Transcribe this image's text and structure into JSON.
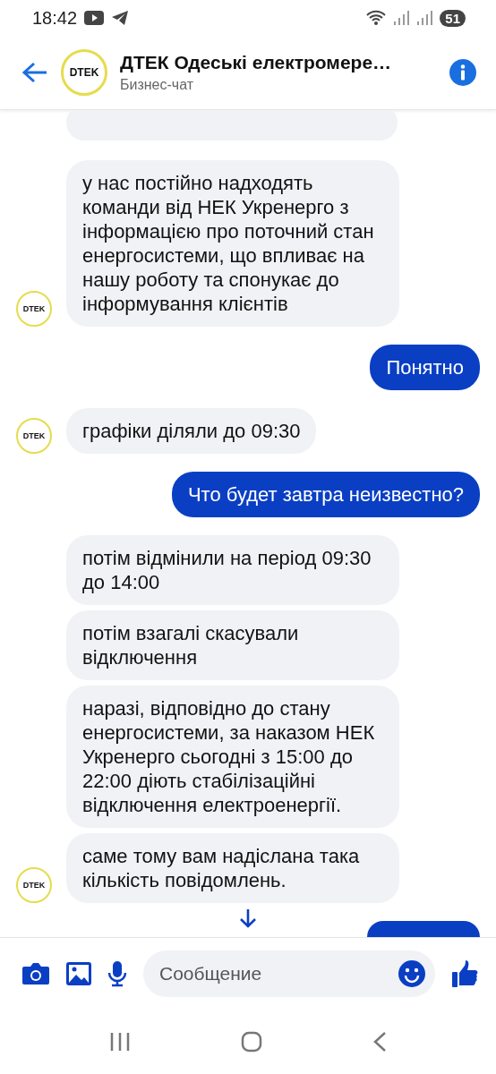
{
  "status_bar": {
    "time": "18:42",
    "battery": "51"
  },
  "header": {
    "title": "ДТЕК Одеські електромере…",
    "subtitle": "Бизнес-чат",
    "logo_text": "DTEK"
  },
  "messages": [
    {
      "kind": "in",
      "text": "у нас постійно надходять команди від НЕК Укренерго з інформацією про поточний стан енергосистеми, що впливає на нашу роботу та спонукає до інформування клієнтів",
      "avatar_text": "DTEK"
    },
    {
      "kind": "out",
      "text": "Понятно"
    },
    {
      "kind": "in",
      "text": "графіки діляли до 09:30",
      "avatar_text": "DTEK"
    },
    {
      "kind": "out",
      "text": "Что будет завтра неизвестно?"
    },
    {
      "kind": "in",
      "text": "потім відмінили на період 09:30 до 14:00"
    },
    {
      "kind": "in",
      "text": "потім взагалі скасували відключення"
    },
    {
      "kind": "in",
      "text": "наразі, відповідно до стану енергосистеми, за наказом НЕК Укренерго сьогодні з 15:00 до 22:00 діють стабілізаційні відключення електроенергії."
    },
    {
      "kind": "in",
      "text": "саме тому вам надіслана така кількість повідомлень.",
      "avatar_text": "DTEK"
    }
  ],
  "composer": {
    "placeholder": "Сообщение"
  }
}
